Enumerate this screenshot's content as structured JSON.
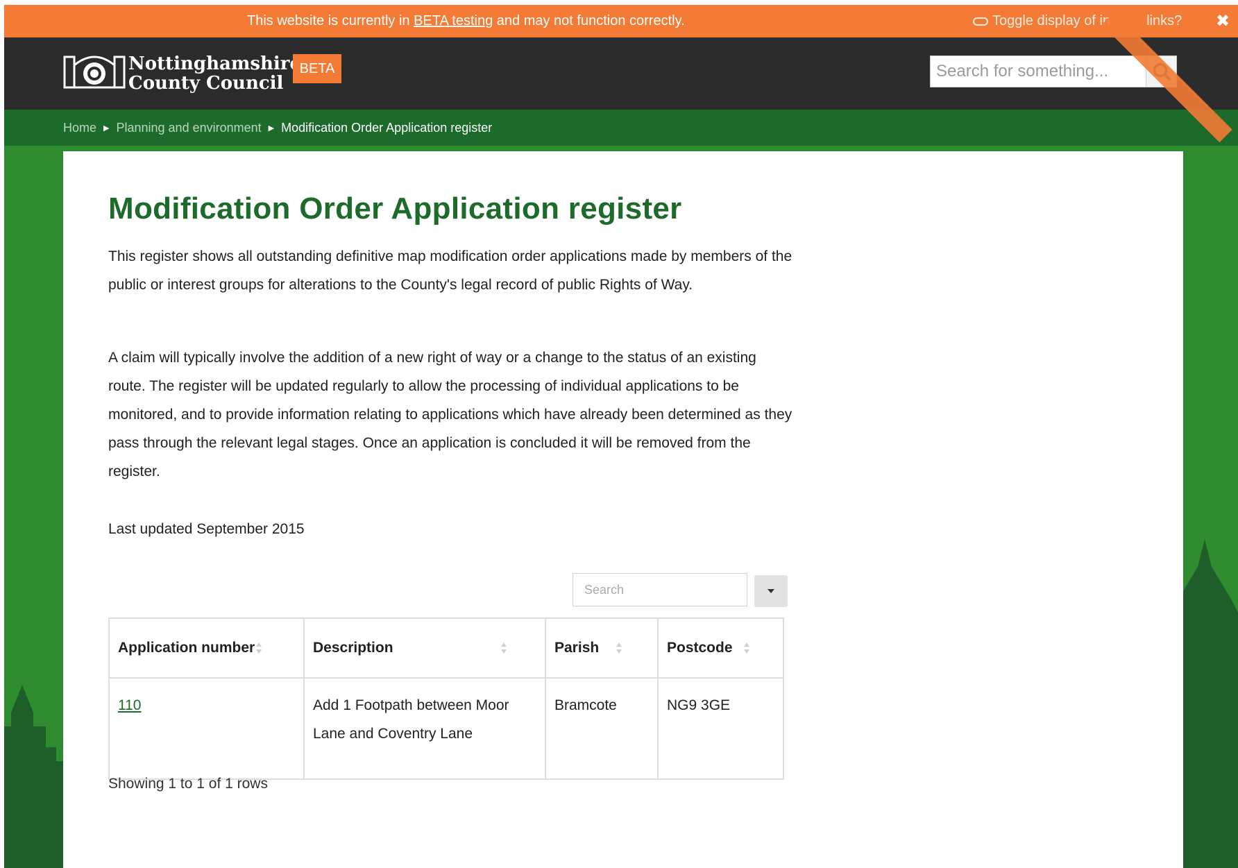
{
  "beta_banner": {
    "text_before": "This website is currently in ",
    "link": "BETA testing",
    "text_after": " and may not function correctly.",
    "toggle_label": "Toggle display of in",
    "toggle_label_end": "links?",
    "close_symbol": "✖"
  },
  "header": {
    "brand_line1": "Nottinghamshire",
    "brand_line2": "County Council",
    "beta_tag": "BETA",
    "search_placeholder": "Search for something..."
  },
  "breadcrumb": {
    "items": [
      "Home",
      "Planning and environment"
    ],
    "current": "Modification Order Application register"
  },
  "main": {
    "title": "Modification Order Application register",
    "paragraph1": "This register shows all outstanding definitive map modification order applications made by members of the public or interest groups for alterations to the County's legal record of public Rights of Way.",
    "paragraph2": "A claim will typically involve the addition of a new right of way or a change to the status of an existing route. The register will be updated regularly to allow the processing of individual applications to be monitored, and to provide information relating to applications which have already been determined as they pass through the relevant legal stages. Once an application is concluded it will be removed from the register.",
    "last_updated": "Last updated September 2015"
  },
  "table": {
    "search_placeholder": "Search",
    "columns": [
      "Application number",
      "Description",
      "Parish",
      "Postcode"
    ],
    "rows": [
      {
        "application_number": "110",
        "description": "Add 1 Footpath between Moor Lane and Coventry Lane",
        "parish": "Bramcote",
        "postcode": "NG9 3GE"
      }
    ],
    "footer": "Showing 1 to 1 of 1 rows"
  },
  "colors": {
    "banner_orange": "#f37b35",
    "header_dark": "#2b2b2b",
    "breadcrumb_green": "#1d6b2a",
    "page_green": "#2e8b2e",
    "title_green": "#1d6b2a"
  },
  "icons": {
    "toggle": "toggle-icon",
    "close": "close-icon",
    "logo": "council-crest-logo",
    "search": "search-icon",
    "sort": "sort-icon",
    "menu": "chevron-down-icon"
  }
}
